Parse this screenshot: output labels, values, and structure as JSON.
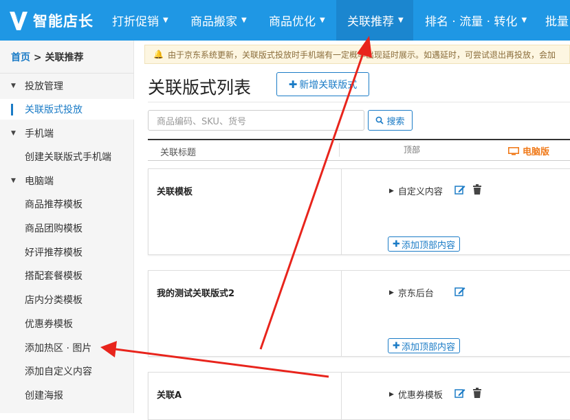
{
  "brand": {
    "name": "智能店长"
  },
  "nav": [
    {
      "label": "打折促销"
    },
    {
      "label": "商品搬家"
    },
    {
      "label": "商品优化"
    },
    {
      "label": "关联推荐"
    },
    {
      "label": "排名 · 流量 · 转化"
    },
    {
      "label": "批量"
    }
  ],
  "breadcrumb": {
    "home": "首页",
    "sep": ">",
    "current": "关联推荐"
  },
  "sidebar": {
    "group1": "投放管理",
    "item_active": "关联版式投放",
    "group2": "手机端",
    "mobile_item": "创建关联版式手机端",
    "group3": "电脑端",
    "pc_items": [
      "商品推荐模板",
      "商品团购模板",
      "好评推荐模板",
      "搭配套餐模板",
      "店内分类模板",
      "优惠券模板",
      "添加热区 · 图片",
      "添加自定义内容",
      "创建海报"
    ]
  },
  "notice": "由于京东系统更新，关联版式投放时手机端有一定概率出现延时展示。如遇延时，可尝试退出再投放，会加",
  "page": {
    "title": "关联版式列表",
    "add_button": "新增关联版式"
  },
  "search": {
    "placeholder": "商品编码、SKU、货号",
    "button": "搜索"
  },
  "table": {
    "col_title": "关联标题",
    "col_top": "顶部",
    "col_pc": "电脑版",
    "rows": [
      {
        "name": "关联模板",
        "content": "自定义内容",
        "add_label": "添加顶部内容"
      },
      {
        "name": "我的测试关联版式2",
        "content": "京东后台",
        "add_label": "添加顶部内容"
      },
      {
        "name": "关联A",
        "content": "优惠券模板"
      }
    ]
  },
  "colors": {
    "topbar": "#1f97e4",
    "accent": "#1a7bc6",
    "pc_label": "#f07a1a",
    "arrow": "#e8241c"
  }
}
